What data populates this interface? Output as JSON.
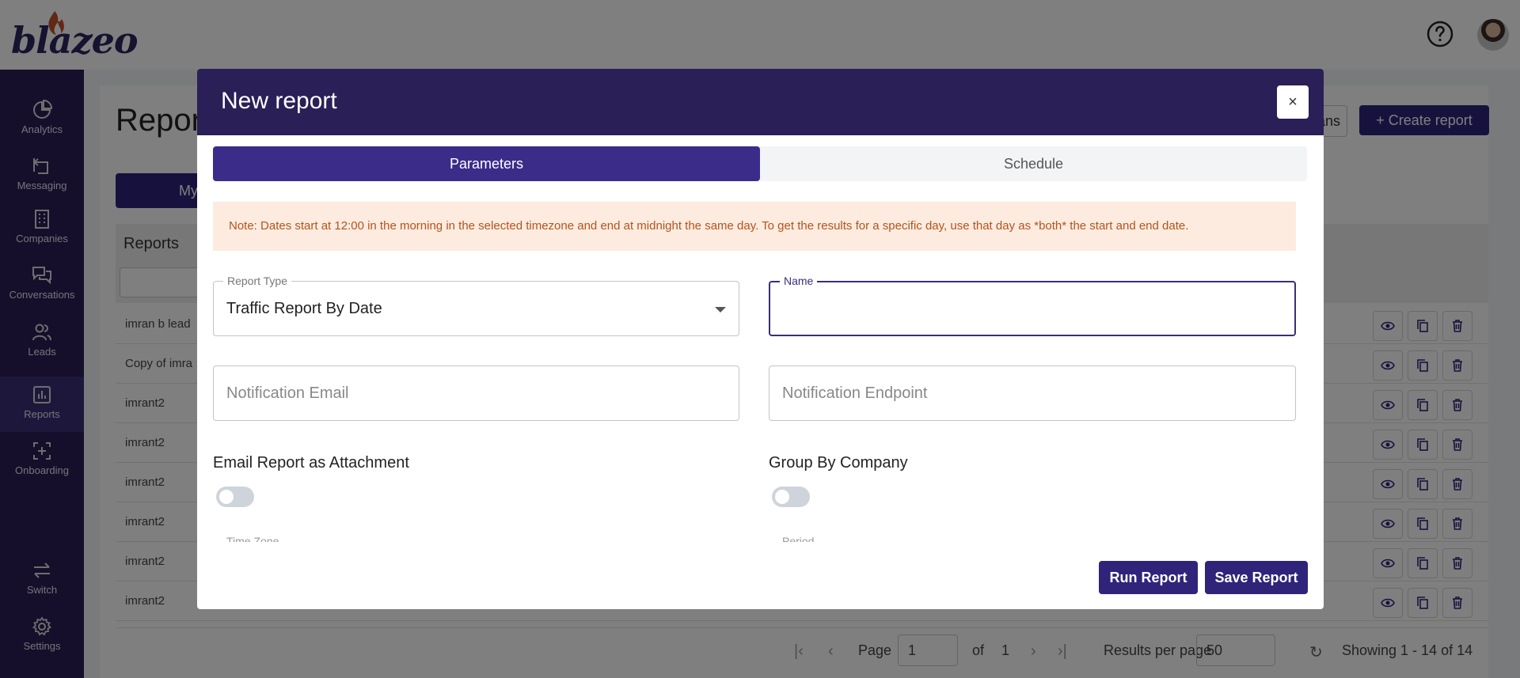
{
  "brand": {
    "name": "blazeo"
  },
  "colors": {
    "primary": "#2f247a",
    "sidebar": "#2a1f56",
    "note_bg": "#fdebe0",
    "note_text": "#b4541a"
  },
  "sidebar": {
    "items": [
      {
        "label": "Analytics",
        "icon": "analytics-icon"
      },
      {
        "label": "Messaging",
        "icon": "messaging-icon"
      },
      {
        "label": "Companies",
        "icon": "companies-icon"
      },
      {
        "label": "Conversations",
        "icon": "conversations-icon"
      },
      {
        "label": "Leads",
        "icon": "leads-icon"
      },
      {
        "label": "Reports",
        "icon": "reports-icon",
        "active": true
      },
      {
        "label": "Onboarding",
        "icon": "onboarding-icon"
      },
      {
        "label": "Switch",
        "icon": "switch-icon"
      },
      {
        "label": "Settings",
        "icon": "gear-icon"
      }
    ]
  },
  "page": {
    "title": "Repor",
    "tab_my": "My",
    "button_partial": "ans",
    "create_button": "+ Create report",
    "table_title": "Reports",
    "rows": [
      "imran b lead",
      "Copy of imra",
      "imrant2",
      "imrant2",
      "imrant2",
      "imrant2",
      "imrant2",
      "imrant2"
    ]
  },
  "pager": {
    "page_label": "Page",
    "page_value": "1",
    "of_label": "of",
    "total_pages": "1",
    "per_page_label": "Results per page",
    "per_page_value": "50",
    "showing": "Showing 1 - 14 of 14"
  },
  "modal": {
    "title": "New report",
    "close": "×",
    "tabs": {
      "parameters": "Parameters",
      "schedule": "Schedule"
    },
    "note": "Note: Dates start at 12:00 in the morning in the selected timezone and end at midnight the same day. To get the results for a specific day, use that day as *both* the start and end date.",
    "report_type": {
      "label": "Report Type",
      "value": "Traffic Report By Date"
    },
    "name": {
      "label": "Name",
      "value": ""
    },
    "notification_email": {
      "placeholder": "Notification Email"
    },
    "notification_endpoint": {
      "placeholder": "Notification Endpoint"
    },
    "email_attachment": {
      "label": "Email Report as Attachment",
      "on": false
    },
    "group_by_company": {
      "label": "Group By Company",
      "on": false
    },
    "time_zone_label": "Time Zone",
    "period_label": "Period",
    "run_button": "Run Report",
    "save_button": "Save Report"
  }
}
